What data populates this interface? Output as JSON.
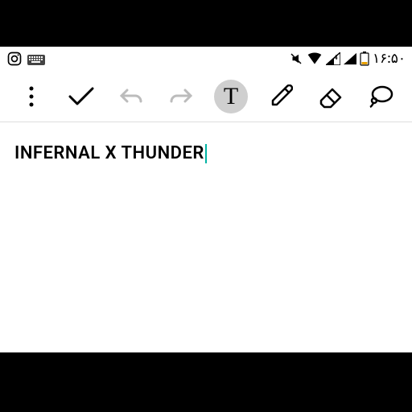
{
  "statusbar": {
    "time": "۱۶:۵۰"
  },
  "toolbar": {
    "text_tool_glyph": "T"
  },
  "editor": {
    "content": "INFERNAL X THUNDER"
  }
}
